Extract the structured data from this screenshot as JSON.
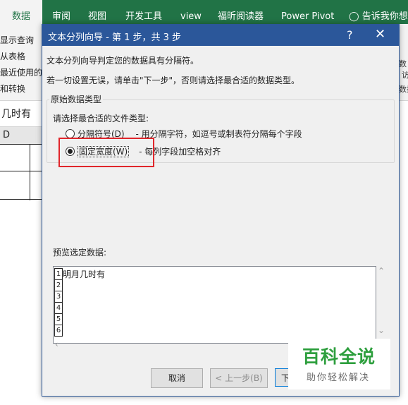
{
  "ribbon": {
    "tabs": [
      "数据",
      "审阅",
      "视图",
      "开发工具",
      "view",
      "福昕阅读器",
      "Power Pivot",
      "告诉我你想要"
    ],
    "left_commands": [
      "显示查询",
      "从表格",
      "最近使用的",
      "和转换"
    ],
    "right_commands": [
      "数",
      "访",
      "数据"
    ]
  },
  "sheet": {
    "formula_value": "几时有",
    "column_header": "D"
  },
  "dialog": {
    "title": "文本分列向导 - 第 1 步，共 3 步",
    "help_glyph": "?",
    "close_glyph": "✕",
    "intro_line1": "文本分列向导判定您的数据具有分隔符。",
    "intro_line2": "若一切设置无误，请单击\"下一步\"，否则请选择最合适的数据类型。",
    "group_legend": "原始数据类型",
    "group_prompt": "请选择最合适的文件类型:",
    "options": [
      {
        "label": "分隔符号(D)",
        "desc": "- 用分隔字符，如逗号或制表符分隔每个字段",
        "selected": false
      },
      {
        "label": "固定宽度(W)",
        "desc": "- 每列字段加空格对齐",
        "selected": true
      }
    ],
    "preview_label": "预览选定数据:",
    "preview_rows": [
      "1",
      "2",
      "3",
      "4",
      "5",
      "6"
    ],
    "preview_text": "明月几时有",
    "buttons": {
      "cancel": "取消",
      "back": "< 上一步(B)",
      "next": "下"
    }
  },
  "watermark": {
    "main": "百科全说",
    "sub": "助你轻松解决"
  },
  "colors": {
    "excel_green": "#217346",
    "dialog_title": "#2b579a",
    "highlight_red": "#e0262b",
    "watermark_green": "#2e9f3e"
  }
}
